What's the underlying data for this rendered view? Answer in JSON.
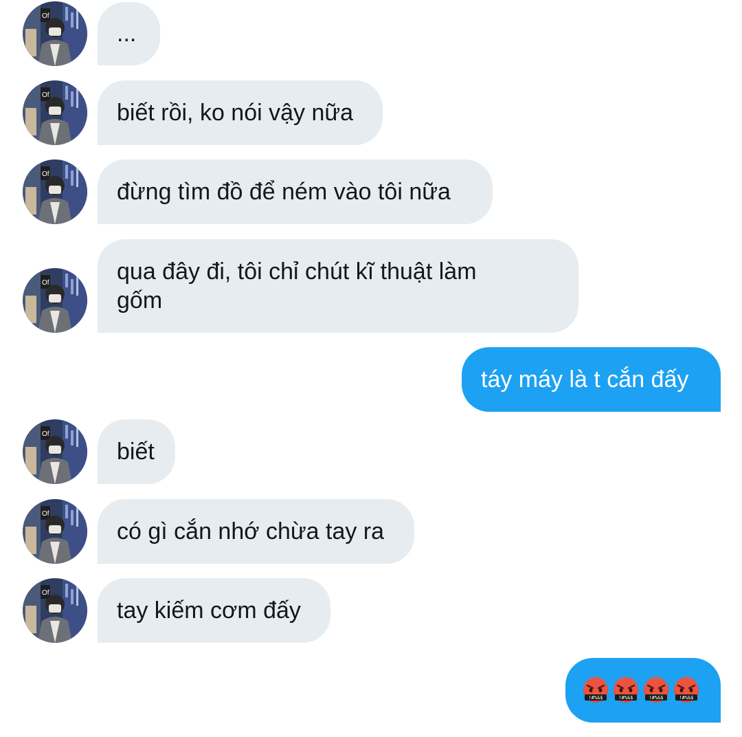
{
  "conversation": {
    "messages": [
      {
        "side": "received",
        "text": "..."
      },
      {
        "side": "received",
        "text": "biết rồi, ko nói vậy nữa"
      },
      {
        "side": "received",
        "text": "đừng tìm đồ để ném vào tôi nữa"
      },
      {
        "side": "received",
        "text": "qua đây đi, tôi chỉ chút kĩ thuật làm gốm"
      },
      {
        "side": "sent",
        "text": "táy máy là t cắn đấy"
      },
      {
        "side": "received",
        "text": "biết"
      },
      {
        "side": "received",
        "text": "có gì cắn nhớ chừa tay ra"
      },
      {
        "side": "received",
        "text": "tay kiếm cơm đấy"
      },
      {
        "side": "sent",
        "emoji": "face-with-symbols-on-mouth",
        "count": 4
      }
    ]
  },
  "emoji": {
    "symbol_text": "!#%&$",
    "icon": "face-with-symbols-on-mouth-icon"
  },
  "colors": {
    "received_bubble": "#e6ecf0",
    "sent_bubble": "#1da1f2",
    "received_text": "#14171a",
    "sent_text": "#ffffff"
  },
  "avatar": {
    "icon": "contact-avatar-icon"
  }
}
